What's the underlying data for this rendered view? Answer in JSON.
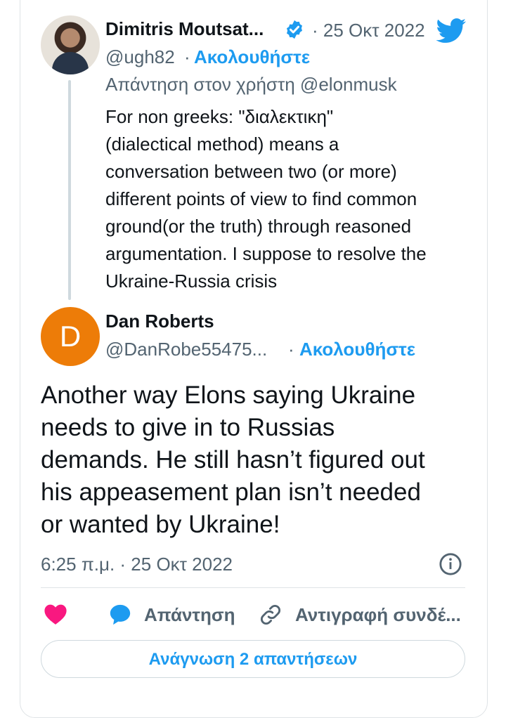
{
  "parent_tweet": {
    "author_name": "Dimitris Moutsat...",
    "date": "· 25 Οκτ 2022",
    "handle": "@ugh82",
    "separator": "·",
    "follow_label": "Ακολουθήστε",
    "reply_to": "Απάντηση στον χρήστη @elonmusk",
    "text_lines": [
      "For non greeks: \"διαλεκτικη\"",
      "(dialectical method) means  a",
      "conversation between two (or more)",
      "different points of view to find common",
      "ground(or the truth) through reasoned",
      "argumentation. I suppose to resolve the",
      "Ukraine-Russia crisis"
    ]
  },
  "main_tweet": {
    "avatar_letter": "D",
    "author_name": "Dan Roberts",
    "handle": "@DanRobe55475...",
    "separator": "·",
    "follow_label": "Ακολουθήστε",
    "text_lines": [
      "Another way Elons saying Ukraine",
      "needs to give in to Russias",
      "demands. He still hasn’t figured out",
      "his appeasement plan isn’t needed",
      "or wanted by Ukraine!"
    ],
    "timestamp": "6:25 π.μ. · 25 Οκτ 2022"
  },
  "actions": {
    "reply_label": "Απάντηση",
    "copy_link_label": "Αντιγραφή συνδέ..."
  },
  "read_replies_label": "Ανάγνωση 2 απαντήσεων",
  "icons": {
    "like": "heart-icon",
    "reply": "speech-bubble-icon",
    "copy_link": "link-icon",
    "info": "info-icon",
    "brand": "twitter-bird-icon",
    "verified": "verified-badge-icon"
  },
  "colors": {
    "accent": "#1d9bf0",
    "like": "#f91880",
    "muted": "#536471",
    "avatar_d_bg": "#ed7c08"
  }
}
